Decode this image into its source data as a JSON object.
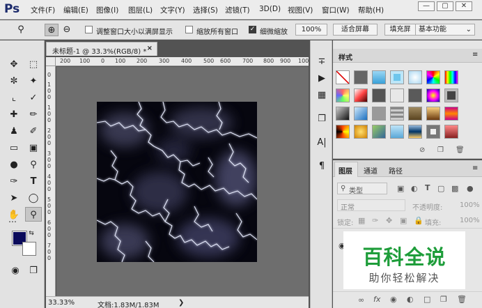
{
  "app": {
    "logo": "Ps",
    "menu": [
      "文件(F)",
      "编辑(E)",
      "图像(I)",
      "图层(L)",
      "文字(Y)",
      "选择(S)",
      "滤镜(T)",
      "3D(D)",
      "视图(V)",
      "窗口(W)",
      "帮助(H)"
    ],
    "window_buttons": {
      "minimize": "—",
      "restore": "▢",
      "close": "✕"
    }
  },
  "options_bar": {
    "resize_windows_label": "调整窗口大小以满屏显示",
    "zoom_all_label": "缩放所有窗口",
    "scrubby_zoom_label": "细微缩放",
    "actual_pixels": "100%",
    "fit_screen": "适合屏幕",
    "fill_screen": "填充屏",
    "workspace": "基本功能"
  },
  "document": {
    "tab_title": "未标题-1 @ 33.3%(RGB/8) *",
    "tab_close": "×",
    "ruler_h": [
      "200",
      "100",
      "0",
      "100",
      "200",
      "300",
      "400",
      "500",
      "600",
      "700",
      "800",
      "900",
      "100"
    ],
    "ruler_v": [
      "0",
      "1",
      "0",
      "0",
      "1",
      "0",
      "0",
      "2",
      "0",
      "0",
      "3",
      "0",
      "0",
      "4",
      "0",
      "0",
      "5",
      "0",
      "0",
      "6",
      "0",
      "0",
      "7",
      "0",
      "0"
    ],
    "zoom": "33.33%",
    "doc_size": "文档:1.83M/1.83M"
  },
  "styles_panel": {
    "tab": "样式"
  },
  "layers_panel": {
    "tabs": [
      "图层",
      "通道",
      "路径"
    ],
    "filter_type": "类型",
    "blend_mode": "正常",
    "opacity_label": "不透明度:",
    "opacity_value": "100%",
    "lock_label": "锁定:",
    "fill_label": "填充:",
    "fill_value": "100%"
  },
  "watermark": {
    "title": "百科全说",
    "subtitle": "助你轻松解决"
  },
  "colors": {
    "foreground": "#0a0a5a",
    "background": "#ffffff",
    "watermark_green": "#1e9d3a"
  }
}
